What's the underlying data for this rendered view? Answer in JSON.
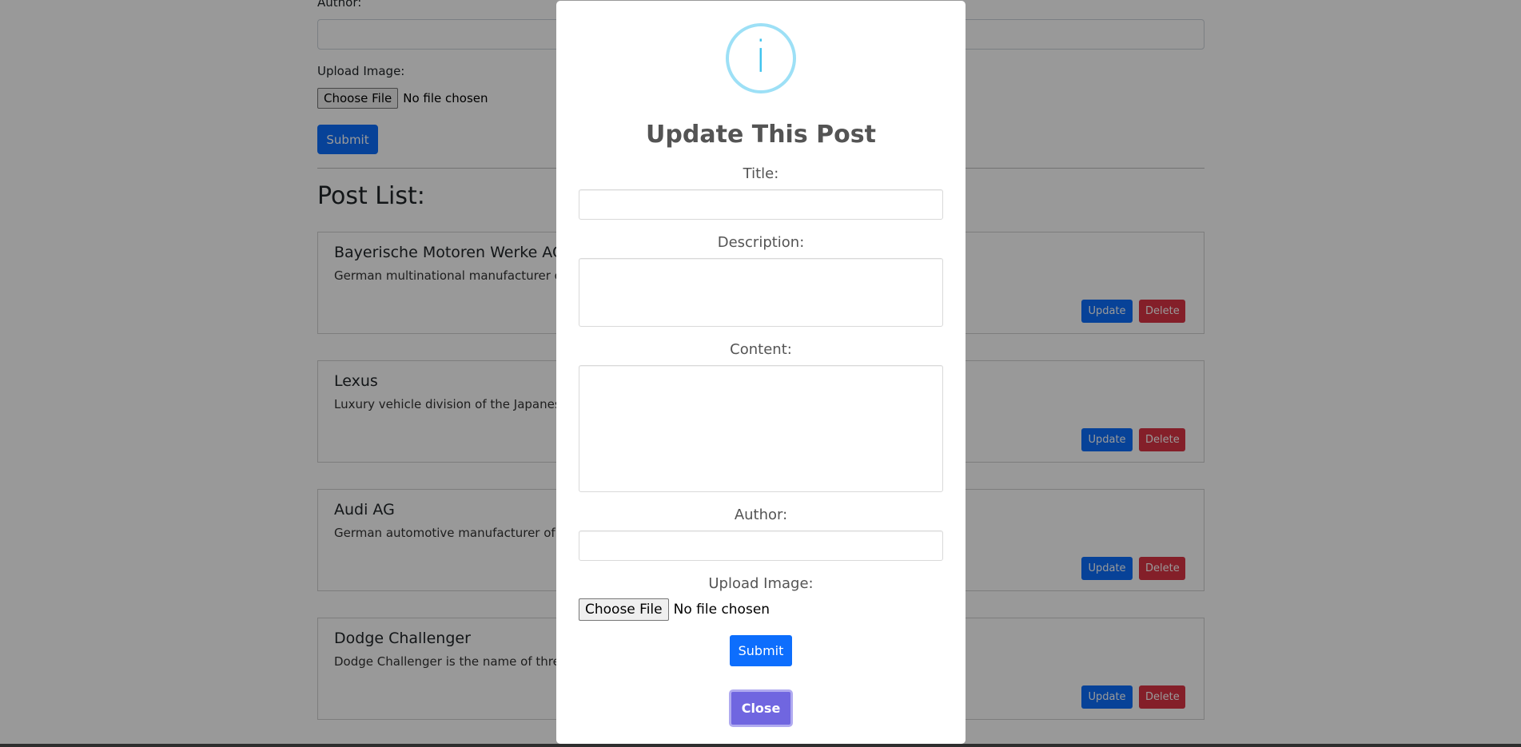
{
  "background_form": {
    "author_label": "Author:",
    "upload_label": "Upload Image:",
    "choose_file_label": "Choose File",
    "no_file_text": "No file chosen",
    "submit_label": "Submit"
  },
  "post_list": {
    "title": "Post List:",
    "update_label": "Update",
    "delete_label": "Delete",
    "posts": [
      {
        "title": "Bayerische Motoren Werke AG",
        "description": "German multinational manufacturer of l"
      },
      {
        "title": "Lexus",
        "description": "Luxury vehicle division of the Japanese a"
      },
      {
        "title": "Audi AG",
        "description": "German automotive manufacturer of lux"
      },
      {
        "title": "Dodge Challenger",
        "description": "Dodge Challenger is the name of three"
      }
    ]
  },
  "modal": {
    "icon_glyph": "i",
    "icon": "info-icon",
    "title": "Update This Post",
    "title_label": "Title:",
    "description_label": "Description:",
    "content_label": "Content:",
    "author_label": "Author:",
    "upload_label": "Upload Image:",
    "choose_file_label": "Choose File",
    "no_file_text": "No file chosen",
    "submit_label": "Submit",
    "close_label": "Close"
  },
  "colors": {
    "primary": "#0d6efd",
    "danger": "#dc3545",
    "confirm": "#7066e0",
    "info": "#3fc3ee"
  }
}
